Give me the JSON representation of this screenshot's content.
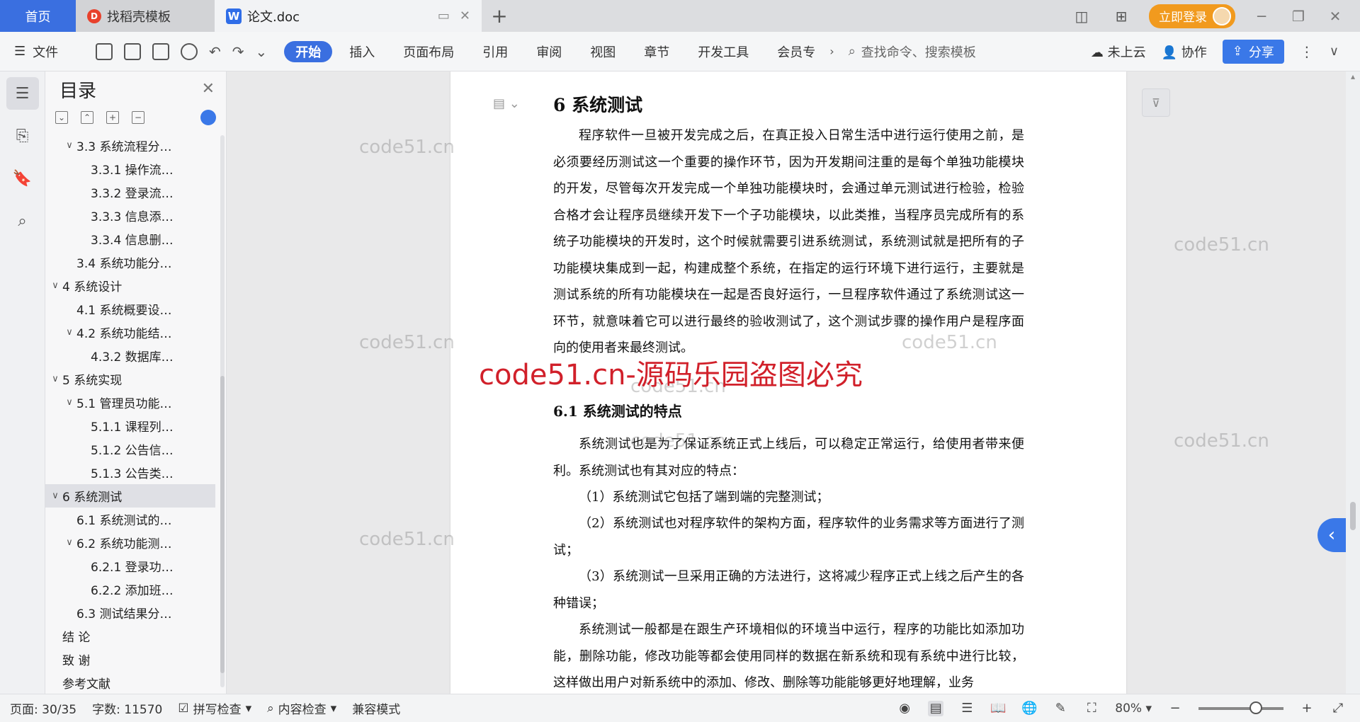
{
  "titlebar": {
    "tabs": [
      {
        "label": "首页"
      },
      {
        "label": "找稻壳模板"
      },
      {
        "label": "论文.doc"
      }
    ],
    "new_tab": "+",
    "login_label": "立即登录"
  },
  "menubar": {
    "file_label": "文件",
    "tabs": [
      "开始",
      "插入",
      "页面布局",
      "引用",
      "审阅",
      "视图",
      "章节",
      "开发工具",
      "会员专"
    ],
    "search_placeholder": "查找命令、搜索模板",
    "cloud_label": "未上云",
    "collab_label": "协作",
    "share_label": "分享"
  },
  "toc": {
    "title": "目录",
    "items": [
      {
        "label": "3.3 系统流程分…",
        "level": 2,
        "caret": "∨"
      },
      {
        "label": "3.3.1  操作流…",
        "level": 3,
        "caret": ""
      },
      {
        "label": "3.3.2  登录流…",
        "level": 3,
        "caret": ""
      },
      {
        "label": "3.3.3  信息添…",
        "level": 3,
        "caret": ""
      },
      {
        "label": "3.3.4  信息删…",
        "level": 3,
        "caret": ""
      },
      {
        "label": "3.4  系统功能分…",
        "level": 2,
        "caret": ""
      },
      {
        "label": "4  系统设计",
        "level": 1,
        "caret": "∨"
      },
      {
        "label": "4.1  系统概要设…",
        "level": 2,
        "caret": ""
      },
      {
        "label": "4.2  系统功能结…",
        "level": 2,
        "caret": "∨"
      },
      {
        "label": "4.3.2  数据库…",
        "level": 3,
        "caret": ""
      },
      {
        "label": "5  系统实现",
        "level": 1,
        "caret": "∨"
      },
      {
        "label": "5.1  管理员功能…",
        "level": 2,
        "caret": "∨"
      },
      {
        "label": "5.1.1  课程列…",
        "level": 3,
        "caret": ""
      },
      {
        "label": "5.1.2  公告信…",
        "level": 3,
        "caret": ""
      },
      {
        "label": "5.1.3 公告类…",
        "level": 3,
        "caret": ""
      },
      {
        "label": "6  系统测试",
        "level": 1,
        "caret": "∨",
        "active": true
      },
      {
        "label": "6.1  系统测试的…",
        "level": 2,
        "caret": ""
      },
      {
        "label": "6.2  系统功能测…",
        "level": 2,
        "caret": "∨"
      },
      {
        "label": "6.2.1  登录功…",
        "level": 3,
        "caret": ""
      },
      {
        "label": "6.2.2  添加班…",
        "level": 3,
        "caret": ""
      },
      {
        "label": "6.3  测试结果分…",
        "level": 2,
        "caret": ""
      },
      {
        "label": "结  论",
        "level": 1,
        "caret": ""
      },
      {
        "label": "致  谢",
        "level": 1,
        "caret": ""
      },
      {
        "label": "参考文献",
        "level": 1,
        "caret": ""
      }
    ]
  },
  "document": {
    "heading": "6  系统测试",
    "para1": "程序软件一旦被开发完成之后，在真正投入日常生活中进行运行使用之前，是必须要经历测试这一个重要的操作环节，因为开发期间注重的是每个单独功能模块的开发，尽管每次开发完成一个单独功能模块时，会通过单元测试进行检验，检验合格才会让程序员继续开发下一个子功能模块，以此类推，当程序员完成所有的系统子功能模块的开发时，这个时候就需要引进系统测试，系统测试就是把所有的子功能模块集成到一起，构建成整个系统，在指定的运行环境下进行运行，主要就是测试系统的所有功能模块在一起是否良好运行，一旦程序软件通过了系统测试这一环节，就意味着它可以进行最终的验收测试了，这个测试步骤的操作用户是程序面向的使用者来最终测试。",
    "subheading": "6.1  系统测试的特点",
    "para2": "系统测试也是为了保证系统正式上线后，可以稳定正常运行，给使用者带来便利。系统测试也有其对应的特点：",
    "item1": "（1）系统测试它包括了端到端的完整测试；",
    "item2": "（2）系统测试也对程序软件的架构方面，程序软件的业务需求等方面进行了测试；",
    "item3": "（3）系统测试一旦采用正确的方法进行，这将减少程序正式上线之后产生的各种错误；",
    "para3": "系统测试一般都是在跟生产环境相似的环境当中运行，程序的功能比如添加功能，删除功能，修改功能等都会使用同样的数据在新系统和现有系统中进行比较，这样做出用户对新系统中的添加、修改、删除等功能能够更好地理解，业务"
  },
  "watermark": {
    "small": "code51.cn",
    "big": "code51.cn-源码乐园盗图必究"
  },
  "statusbar": {
    "page": "页面: 30/35",
    "words": "字数: 11570",
    "spell": "拼写检查",
    "content": "内容检查",
    "compat": "兼容模式",
    "zoom": "80%"
  }
}
